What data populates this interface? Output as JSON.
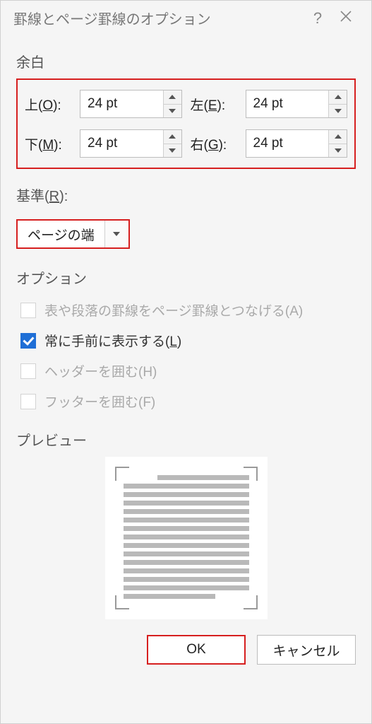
{
  "title": "罫線とページ罫線のオプション",
  "help_symbol": "?",
  "sections": {
    "margin_label": "余白",
    "options_label": "オプション",
    "preview_label": "プレビュー"
  },
  "margin": {
    "top": {
      "label_pre": "上(",
      "label_u": "O",
      "label_post": "):",
      "value": "24 pt"
    },
    "left": {
      "label_pre": "左(",
      "label_u": "E",
      "label_post": "):",
      "value": "24 pt"
    },
    "bottom": {
      "label_pre": "下(",
      "label_u": "M",
      "label_post": "):",
      "value": "24 pt"
    },
    "right": {
      "label_pre": "右(",
      "label_u": "G",
      "label_post": "):",
      "value": "24 pt"
    }
  },
  "measure_from": {
    "label_pre": "基準(",
    "label_u": "R",
    "label_post": "):",
    "value": "ページの端"
  },
  "options": {
    "align_borders": {
      "label": "表や段落の罫線をページ罫線とつなげる(A)",
      "checked": false,
      "enabled": false
    },
    "always_front": {
      "label_pre": "常に手前に表示する(",
      "label_u": "L",
      "label_post": ")",
      "checked": true,
      "enabled": true
    },
    "surround_header": {
      "label": "ヘッダーを囲む(H)",
      "checked": false,
      "enabled": false
    },
    "surround_footer": {
      "label": "フッターを囲む(F)",
      "checked": false,
      "enabled": false
    }
  },
  "buttons": {
    "ok": "OK",
    "cancel": "キャンセル"
  }
}
